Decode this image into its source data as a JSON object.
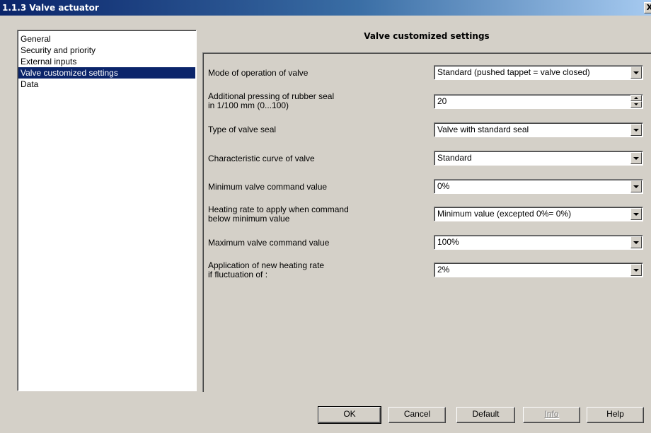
{
  "window": {
    "title": "1.1.3 Valve actuator",
    "close_glyph": "X"
  },
  "nav": {
    "items": [
      {
        "label": "General"
      },
      {
        "label": "Security and priority"
      },
      {
        "label": "External inputs"
      },
      {
        "label": "Valve customized settings",
        "selected": true
      },
      {
        "label": "Data"
      }
    ]
  },
  "panel": {
    "title": "Valve customized settings",
    "params": [
      {
        "label": "Mode of operation of valve",
        "value": "Standard (pushed tappet = valve closed)",
        "control": "combo"
      },
      {
        "label": "Additional pressing of rubber seal\nin 1/100 mm (0...100)",
        "value": "20",
        "control": "spin"
      },
      {
        "label": "Type of valve seal",
        "value": "Valve with standard seal",
        "control": "combo"
      },
      {
        "label": "Characteristic curve of valve",
        "value": "Standard",
        "control": "combo"
      },
      {
        "label": "Minimum valve command value",
        "value": "0%",
        "control": "combo"
      },
      {
        "label": "Heating rate to apply when command\nbelow minimum value",
        "value": "Minimum value (excepted 0%= 0%)",
        "control": "combo"
      },
      {
        "label": "Maximum valve command value",
        "value": "100%",
        "control": "combo"
      },
      {
        "label": "Application of new heating rate\nif fluctuation of :",
        "value": "2%",
        "control": "combo"
      }
    ]
  },
  "buttons": {
    "ok": "OK",
    "cancel": "Cancel",
    "default": "Default",
    "info": "Info",
    "help": "Help"
  }
}
